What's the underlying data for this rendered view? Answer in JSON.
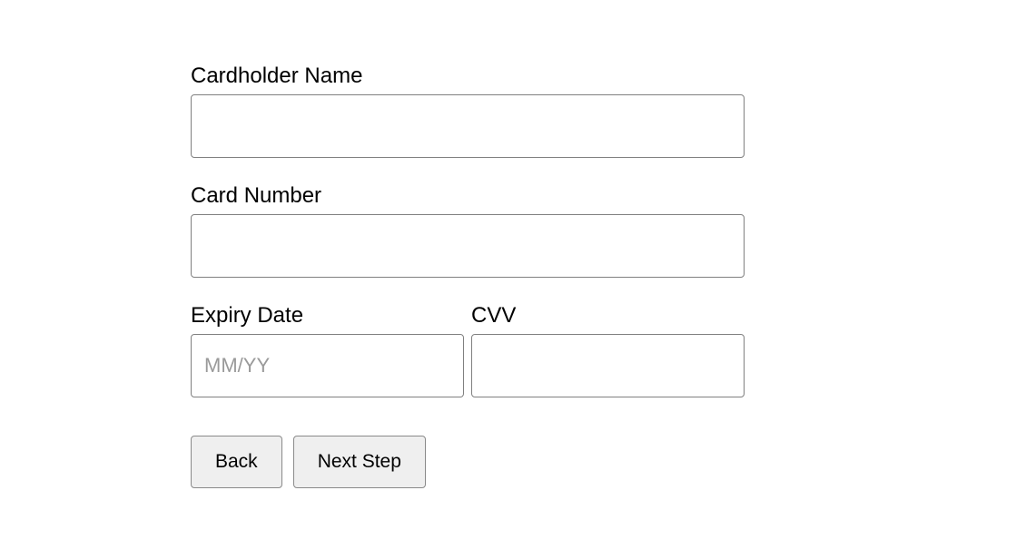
{
  "form": {
    "cardholder_name": {
      "label": "Cardholder Name",
      "value": "",
      "placeholder": ""
    },
    "card_number": {
      "label": "Card Number",
      "value": "",
      "placeholder": ""
    },
    "expiry_date": {
      "label": "Expiry Date",
      "value": "",
      "placeholder": "MM/YY"
    },
    "cvv": {
      "label": "CVV",
      "value": "",
      "placeholder": ""
    }
  },
  "buttons": {
    "back": "Back",
    "next": "Next Step"
  }
}
